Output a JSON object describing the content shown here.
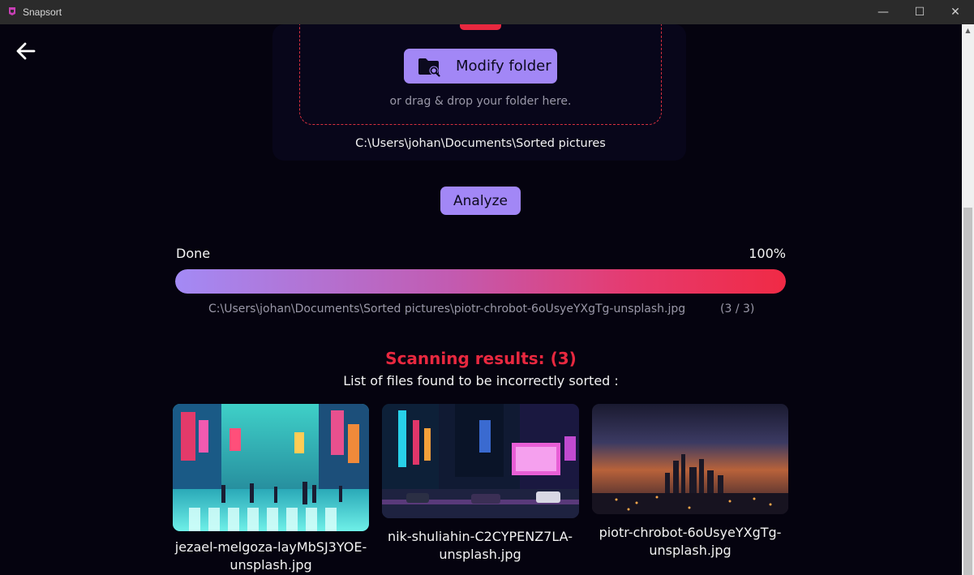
{
  "window": {
    "title": "Snapsort",
    "minimize_glyph": "—",
    "maximize_glyph": "☐",
    "close_glyph": "✕"
  },
  "colors": {
    "accent": "#a287f6",
    "danger": "#e8283f",
    "background": "#05030f"
  },
  "drop_zone": {
    "modify_button_label": "Modify folder",
    "modify_button_icon": "folder-search-icon",
    "drag_hint": "or drag & drop your folder here.",
    "selected_path": "C:\\Users\\johan\\Documents\\Sorted pictures"
  },
  "analyze": {
    "button_label": "Analyze"
  },
  "progress": {
    "status": "Done",
    "percent_label": "100%",
    "percent_value": 100,
    "current_file": "C:\\Users\\johan\\Documents\\Sorted pictures\\piotr-chrobot-6oUsyeYXgTg-unsplash.jpg",
    "count": "(3 / 3)"
  },
  "results": {
    "title": "Scanning results: (3)",
    "subtitle": "List of files found to be incorrectly sorted :",
    "items": [
      {
        "line1": "jezael-melgoza-layMbSJ3YOE-",
        "line2": "unsplash.jpg"
      },
      {
        "line1": "nik-shuliahin-C2CYPENZ7LA-",
        "line2": "unsplash.jpg"
      },
      {
        "line1": "piotr-chrobot-6oUsyeYXgTg-",
        "line2": "unsplash.jpg"
      }
    ]
  }
}
